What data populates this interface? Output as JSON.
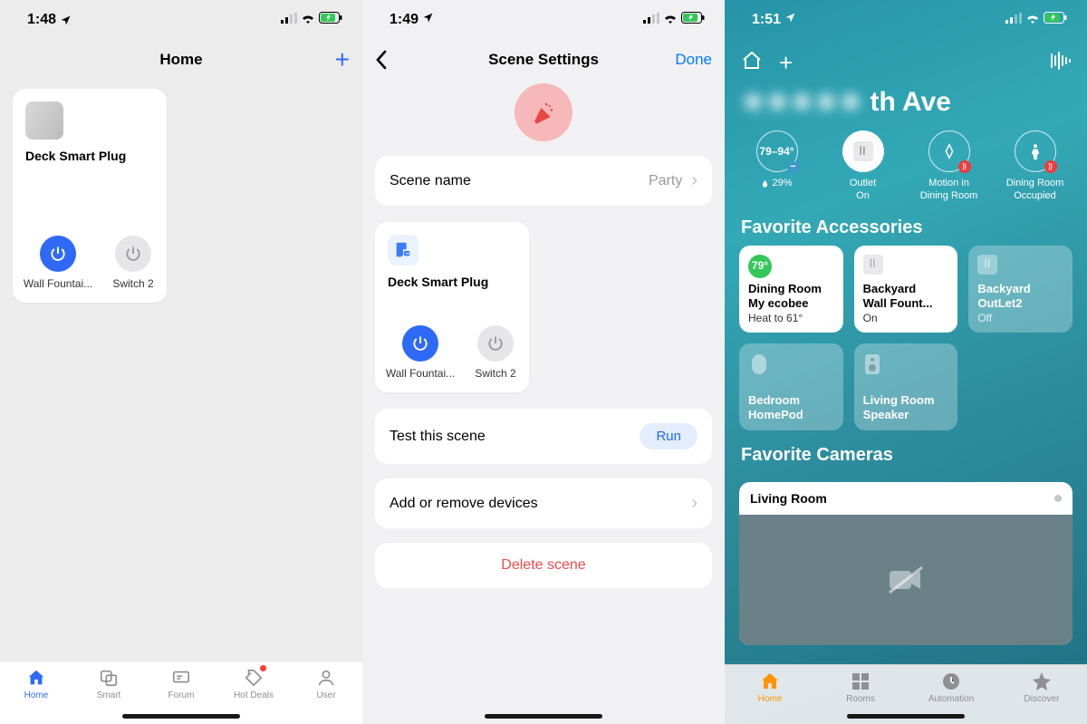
{
  "phone1": {
    "time": "1:48",
    "title": "Home",
    "device": {
      "name": "Deck Smart Plug"
    },
    "switches": [
      {
        "label": "Wall Fountai...",
        "on": true
      },
      {
        "label": "Switch 2",
        "on": false
      }
    ],
    "tabs": [
      "Home",
      "Smart",
      "Forum",
      "Hot Deals",
      "User"
    ]
  },
  "phone2": {
    "time": "1:49",
    "title": "Scene Settings",
    "done": "Done",
    "sceneNameLabel": "Scene name",
    "sceneNameValue": "Party",
    "device": {
      "name": "Deck Smart Plug"
    },
    "switches": [
      {
        "label": "Wall Fountai...",
        "on": true
      },
      {
        "label": "Switch 2",
        "on": false
      }
    ],
    "testLabel": "Test this scene",
    "runLabel": "Run",
    "addRemove": "Add or remove devices",
    "delete": "Delete scene"
  },
  "phone3": {
    "time": "1:51",
    "titleBlur": "★★★★★ ",
    "titleClear": "th Ave",
    "status": [
      {
        "main": "79–94°",
        "label": "29%",
        "kind": "temp"
      },
      {
        "main": "",
        "label": "Outlet\nOn",
        "kind": "outlet"
      },
      {
        "main": "",
        "label": "Motion in\nDining Room",
        "kind": "motion"
      },
      {
        "main": "",
        "label": "Dining Room\nOccupied",
        "kind": "occupied"
      }
    ],
    "favAccTitle": "Favorite Accessories",
    "accessories": [
      {
        "badge": "79°",
        "line1": "Dining Room",
        "line2": "My ecobee",
        "line3": "Heat to 61°",
        "style": "white",
        "badgeColor": "#34c759"
      },
      {
        "icon": "outlet",
        "line1": "Backyard",
        "line2": "Wall Fount...",
        "line3": "On",
        "style": "white"
      },
      {
        "icon": "outlet",
        "line1": "Backyard",
        "line2": "OutLet2",
        "line3": "Off",
        "style": "trans"
      },
      {
        "icon": "homepod",
        "line1": "Bedroom",
        "line2": "HomePod",
        "line3": "",
        "style": "trans"
      },
      {
        "icon": "speaker",
        "line1": "Living Room",
        "line2": "Speaker",
        "line3": "",
        "style": "trans"
      }
    ],
    "favCamTitle": "Favorite Cameras",
    "cameraName": "Living Room",
    "tabs": [
      "Home",
      "Rooms",
      "Automation",
      "Discover"
    ]
  }
}
